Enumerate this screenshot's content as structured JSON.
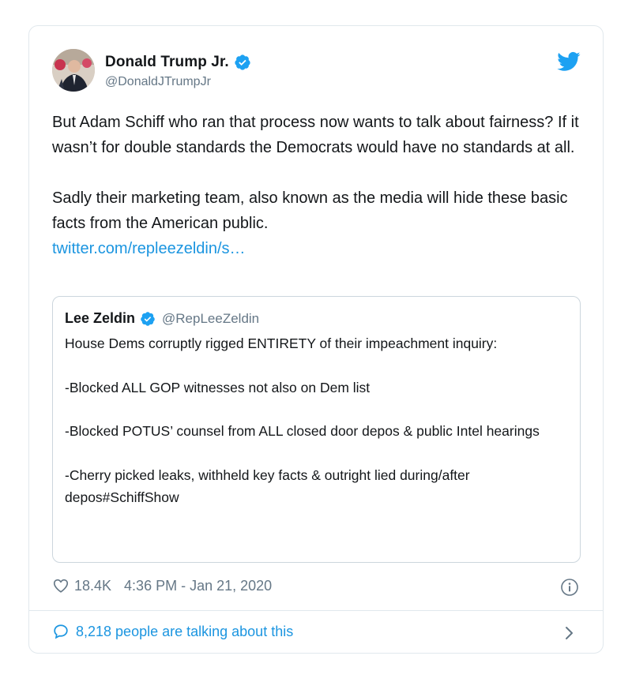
{
  "colors": {
    "link": "#1b95e0",
    "secondary_text": "#657786",
    "border": "#e1e8ed",
    "verified_badge": "#1da1f2"
  },
  "author": {
    "display_name": "Donald Trump Jr.",
    "handle": "@DonaldJTrumpJr",
    "verified": true,
    "avatar_icon": "profile-photo"
  },
  "tweet": {
    "paragraph1": "But Adam Schiff who ran that process now wants to talk about fairness? If it wasn’t for double standards the Democrats would have no standards at all.",
    "paragraph2": "Sadly their marketing team, also known as the media will hide these basic facts from the American public.",
    "link_text": "twitter.com/repleezeldin/s…"
  },
  "quoted_tweet": {
    "display_name": "Lee Zeldin",
    "handle": "@RepLeeZeldin",
    "verified": true,
    "text": "House Dems corruptly rigged ENTIRETY of their impeachment inquiry:\n\n-Blocked ALL GOP witnesses not also on Dem list\n\n-Blocked POTUS’ counsel from ALL closed door depos & public Intel hearings\n\n-Cherry picked leaks, withheld key facts & outright lied during/after depos#SchiffShow"
  },
  "meta": {
    "likes": "18.4K",
    "timestamp": "4:36 PM - Jan 21, 2020"
  },
  "footer": {
    "talking_text": "8,218 people are talking about this"
  },
  "icons": [
    "twitter-bird-icon",
    "verified-badge-icon",
    "heart-icon",
    "info-icon",
    "comment-bubble-icon",
    "chevron-right-icon"
  ]
}
